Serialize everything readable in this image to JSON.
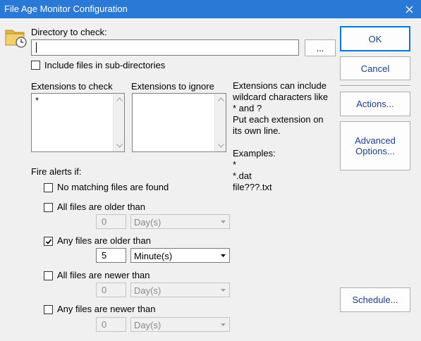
{
  "window": {
    "title": "File Age Monitor Configuration"
  },
  "directory": {
    "label": "Directory to check:",
    "value": "",
    "browse_label": "...",
    "include_subdirs_label": "Include files in sub-directories",
    "include_subdirs_checked": false
  },
  "extensions": {
    "check_label": "Extensions to check",
    "check_value": "*",
    "ignore_label": "Extensions to ignore",
    "ignore_value": "",
    "help_lines": [
      "Extensions can include",
      "wildcard characters like",
      "* and ?",
      "Put each extension on",
      "its own line."
    ],
    "examples_label": "Examples:",
    "examples": [
      "*",
      "*.dat",
      "file???.txt"
    ]
  },
  "alerts": {
    "label": "Fire alerts if:",
    "no_match": {
      "label": "No matching files are found",
      "checked": false
    },
    "all_older": {
      "label": "All files are older than",
      "checked": false,
      "amount": "0",
      "unit": "Day(s)"
    },
    "any_older": {
      "label": "Any files are older than",
      "checked": true,
      "amount": "5",
      "unit": "Minute(s)"
    },
    "all_newer": {
      "label": "All files are newer than",
      "checked": false,
      "amount": "0",
      "unit": "Day(s)"
    },
    "any_newer": {
      "label": "Any files are newer than",
      "checked": false,
      "amount": "0",
      "unit": "Day(s)"
    }
  },
  "buttons": {
    "ok": "OK",
    "cancel": "Cancel",
    "actions": "Actions...",
    "advanced_line1": "Advanced",
    "advanced_line2": "Options...",
    "schedule": "Schedule..."
  },
  "icons": {
    "folder": "folder-clock-icon",
    "close": "close-icon",
    "check": "check-icon",
    "dropdown": "chevron-down-icon"
  },
  "colors": {
    "titlebar": "#2b79d6",
    "button_text": "#1c3e8c",
    "default_border": "#0078d7"
  }
}
